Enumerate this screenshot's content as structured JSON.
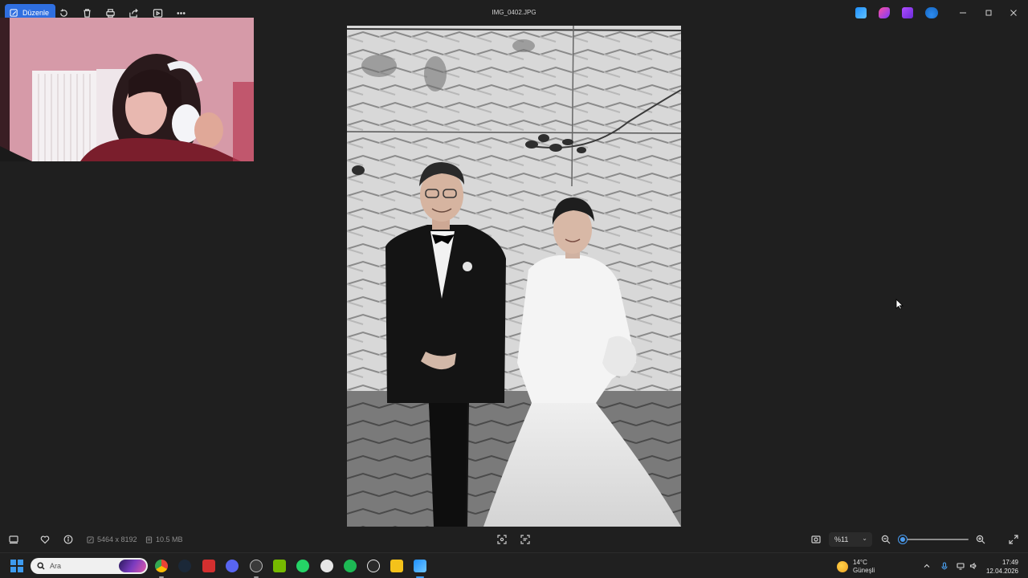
{
  "window": {
    "title": "IMG_0402.JPG",
    "edit_label": "Düzenle"
  },
  "toolbar": {
    "icons": [
      "rotate-icon",
      "delete-icon",
      "print-icon",
      "share-icon",
      "slideshow-icon",
      "more-icon"
    ]
  },
  "bottombar": {
    "dimensions": "5464 x 8192",
    "file_size": "10.5 MB",
    "zoom_value": "%11",
    "zoom_level": 0.02
  },
  "taskbar": {
    "search_placeholder": "Ara",
    "weather_temp": "14°C",
    "weather_desc": "Güneşli",
    "time": "17:49",
    "date": "12.04.2026",
    "accent": "#3d9bf0"
  }
}
